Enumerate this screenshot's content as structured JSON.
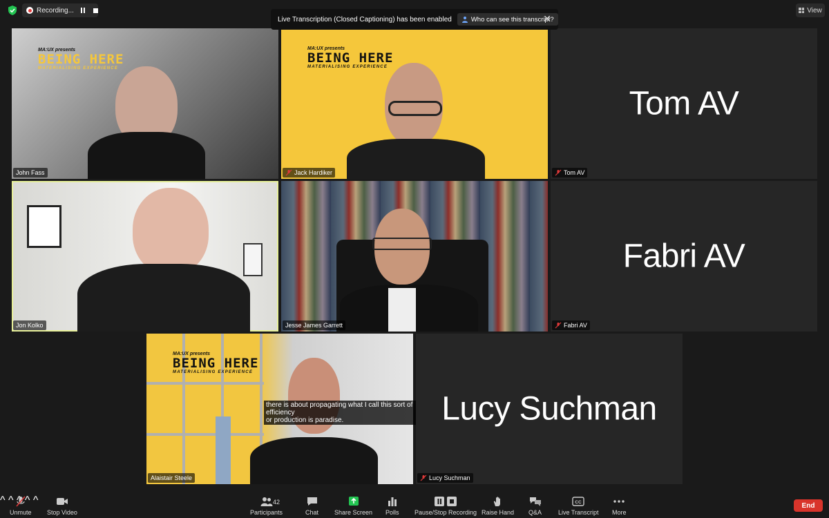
{
  "topbar": {
    "recording_label": "Recording...",
    "banner_text": "Live Transcription (Closed Captioning) has been enabled",
    "who_button": "Who can see this transcript?",
    "close_glyph": "✕",
    "view_label": "View"
  },
  "tiles": [
    {
      "name": "John Fass",
      "muted": false,
      "video": true
    },
    {
      "name": "Jack Hardiker",
      "muted": true,
      "video": true
    },
    {
      "name": "Tom AV",
      "muted": true,
      "video": false
    },
    {
      "name": "Jon Kolko",
      "muted": false,
      "video": true,
      "active": true
    },
    {
      "name": "Jesse James Garrett",
      "muted": false,
      "video": true
    },
    {
      "name": "Fabri AV",
      "muted": true,
      "video": false
    },
    {
      "name": "Alaistair Steele",
      "muted": false,
      "video": true
    },
    {
      "name": "Lucy Suchman",
      "muted": true,
      "video": false
    }
  ],
  "branding": {
    "presents": "MA:UX presents",
    "title": "BEING HERE",
    "subtitle": "MATERIALISING EXPERIENCE"
  },
  "caption": {
    "line1": "there is about propagating what I call this sort of",
    "line2": "efficiency",
    "line3": "or production is paradise."
  },
  "toolbar": {
    "unmute": "Unmute",
    "stop_video": "Stop Video",
    "participants": "Participants",
    "participants_count": "42",
    "chat": "Chat",
    "share_screen": "Share Screen",
    "polls": "Polls",
    "pause_stop_recording": "Pause/Stop Recording",
    "raise_hand": "Raise Hand",
    "qa": "Q&A",
    "live_transcript": "Live Transcript",
    "more": "More",
    "end": "End"
  },
  "colors": {
    "background": "#1a1a1a",
    "tile": "#262626",
    "active_border": "#e7f09a",
    "end_button": "#d9342b",
    "share_green": "#23c552",
    "mute_red": "#e03a3a",
    "brand_yellow": "#f5c73b"
  },
  "icons": [
    "shield-icon",
    "record-icon",
    "pause-icon",
    "stop-icon",
    "person-icon",
    "close-icon",
    "grid-icon",
    "mic-muted-icon",
    "camera-icon",
    "participants-icon",
    "chat-icon",
    "share-screen-icon",
    "polls-icon",
    "pause-stop-icon",
    "hand-icon",
    "qa-icon",
    "cc-icon",
    "more-icon"
  ]
}
